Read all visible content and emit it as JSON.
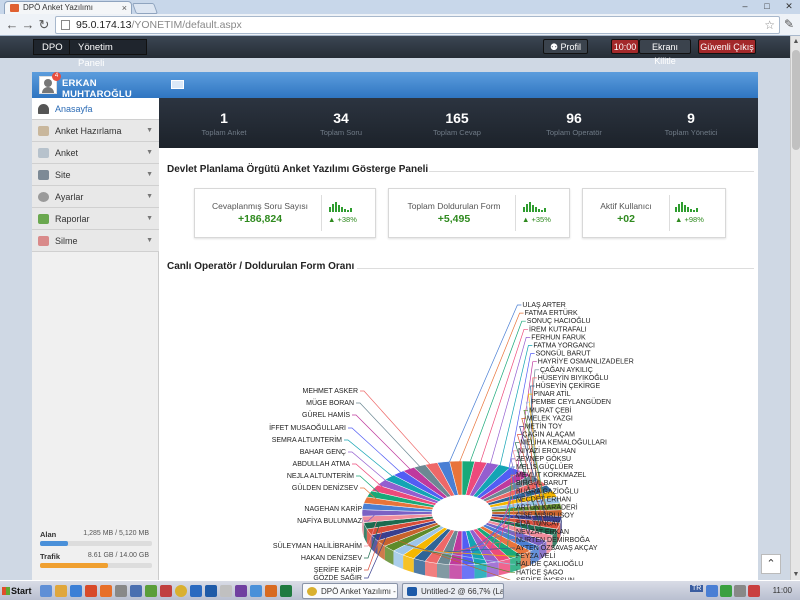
{
  "browser": {
    "tab_title": "DPÖ Anket Yazılımı",
    "tab_close": "×",
    "url_host": "95.0.174.13",
    "url_path": "/YONETIM/default.aspx",
    "back": "←",
    "forward": "→",
    "reload": "↻",
    "star": "☆",
    "wrench": "✎",
    "min": "–",
    "max": "□",
    "close": "✕"
  },
  "topnav": {
    "breadcrumb_root": "DPO",
    "breadcrumb_page": "Yönetim Paneli",
    "profile": "Profil",
    "timer": "10:00",
    "lock": "Ekranı Kilitle",
    "logout": "Güvenli Çıkış"
  },
  "user": {
    "name": "ERKAN MUHTAROĞLU",
    "notification_count": "4"
  },
  "sidebar": {
    "items": [
      {
        "label": "Anasayfa",
        "active": true
      },
      {
        "label": "Anket Hazırlama"
      },
      {
        "label": "Anket"
      },
      {
        "label": "Site"
      },
      {
        "label": "Ayarlar"
      },
      {
        "label": "Raporlar"
      },
      {
        "label": "Silme"
      }
    ],
    "chevron": "▼",
    "storage": {
      "alan_label": "Alan",
      "alan_value": "1,285 MB / 5,120 MB",
      "alan_pct": 25,
      "trafik_label": "Trafik",
      "trafik_value": "8.61 GB / 14.00 GB",
      "trafik_pct": 61
    }
  },
  "stats": [
    {
      "num": "1",
      "label": "Toplam Anket"
    },
    {
      "num": "34",
      "label": "Toplam Soru"
    },
    {
      "num": "165",
      "label": "Toplam Cevap"
    },
    {
      "num": "96",
      "label": "Toplam Operatör"
    },
    {
      "num": "9",
      "label": "Toplam Yönetici"
    }
  ],
  "dashboard": {
    "title": "Devlet Planlama Örgütü Anket Yazılımı Gösterge Paneli",
    "cards": [
      {
        "label": "Cevaplanmış Soru Sayısı",
        "value": "+186,824",
        "pct": "▲ +38%"
      },
      {
        "label": "Toplam Doldurulan Form",
        "value": "+5,495",
        "pct": "▲ +35%"
      },
      {
        "label": "Aktif Kullanıcı",
        "value": "+02",
        "pct": "▲ +98%"
      }
    ],
    "chart_title": "Canlı Operatör / Doldurulan Form Oranı"
  },
  "chart_data": {
    "type": "pie",
    "title": "Canlı Operatör / Doldurulan Form Oranı",
    "labels_right": [
      "ULAŞ ARTER",
      "FATMA ERTÜRK",
      "SONUÇ HACIOĞLU",
      "İREM KUTRAFALI",
      "FERHUN FARUK",
      "FATMA YORGANCI",
      "SONGÜL BARUT",
      "HAYRİYE OSMANLIZADELER",
      "ÇAĞAN AYKILIÇ",
      "HÜSEYİN BIYIKOĞLU",
      "HÜSEYİN ÇEKİRGE",
      "PINAR ATİL",
      "PEMBE CEYLANGÜDEN",
      "MURAT ÇEBİ",
      "MELEK YAZGI",
      "METİN TOY",
      "ÇAĞIN ALAÇAM",
      "MELİHA KEMALOĞULLARI",
      "NİYAZİ EROLHAN",
      "ZEYNEP GÖKSU",
      "MELİS GÜÇLÜER",
      "MEVLİT KORKMAZEL",
      "BİRGÜL BARUT",
      "BUĞRA GAZİOĞLU",
      "NECDET ERHAN",
      "ARTUN KARADERİ",
      "ÇİSE MISIRLISOY",
      "EDA TUNCAY",
      "NEVZAT ERKAN",
      "NURTEN DEMİRBOĞA",
      "AYTEN ÖZSAVAŞ AKÇAY",
      "FEYZA VELİ",
      "HALİDE ÇAKLIOĞLU",
      "HATİCE ŞAGO",
      "ŞERİFE İNCESUN"
    ],
    "labels_left": [
      "MEHMET ASKER",
      "MÜGE BORAN",
      "GÜREL HAMİS",
      "İFFET MUSAOĞULLARI",
      "SEMRA ALTUNTERİM",
      "BAHAR GENÇ",
      "ABDULLAH ATMA",
      "NEJLA ALTUNTERİM",
      "GÜLDEN DENİZSEV",
      "NAGEHAN KARİP",
      "NAFİYA BULUNMAZ",
      "SÜLEYMAN HALİLİBRAHİM",
      "HAKAN DENİZSEV",
      "ŞERİFE KARİP",
      "GÖZDE SAĞIR"
    ],
    "colors": [
      "#4a7fd4",
      "#e8743b",
      "#19a979",
      "#ed4a7b",
      "#945ecf",
      "#13a4b4",
      "#525df4",
      "#bf399e",
      "#6c8893",
      "#ee6868",
      "#2f6497",
      "#f5b700",
      "#9cc5e8",
      "#5e8b2a",
      "#c7632d",
      "#3a3f8f",
      "#d94e3a",
      "#1c6b4f",
      "#f08d9c",
      "#7b61c4"
    ]
  },
  "taskbar": {
    "start": "Start",
    "tasks": [
      "DPÖ Anket Yazılımı - ...",
      "Untitled-2 @ 66,7% (Lay..."
    ],
    "lang": "TR",
    "clock": "11:00"
  },
  "scroll_top": "⌃"
}
